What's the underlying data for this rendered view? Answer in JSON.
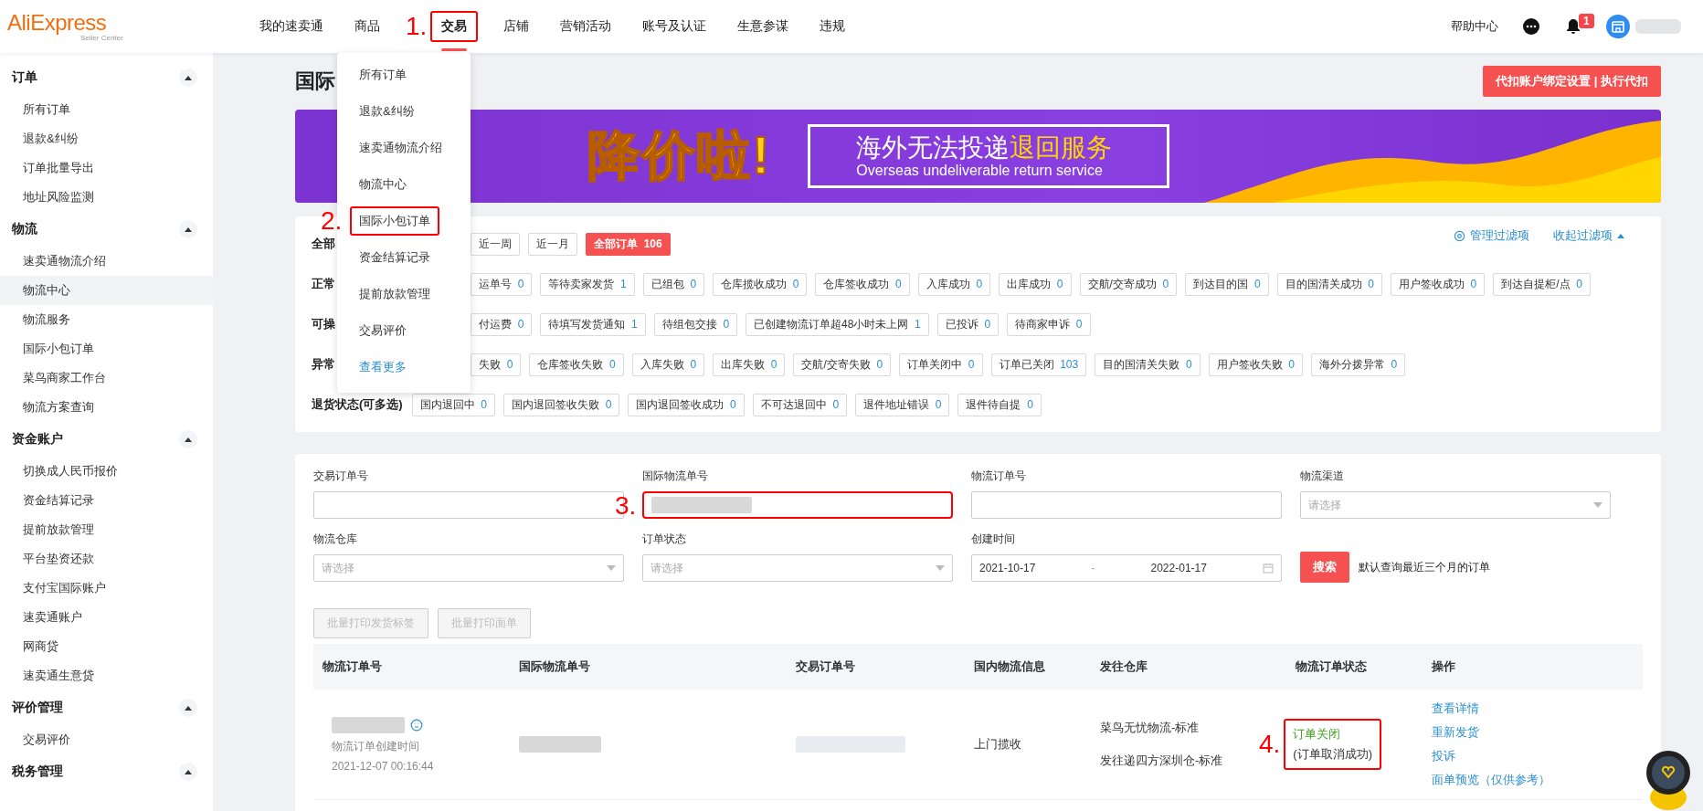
{
  "header": {
    "logo": "AliExpress",
    "logo_sub": "Seller Center",
    "step_label": "1.",
    "nav": [
      {
        "label": "我的速卖通",
        "selected": false,
        "highlighted": false
      },
      {
        "label": "商品",
        "selected": false,
        "highlighted": false
      },
      {
        "label": "交易",
        "selected": true,
        "highlighted": true
      },
      {
        "label": "店铺",
        "selected": false,
        "highlighted": false
      },
      {
        "label": "营销活动",
        "selected": false,
        "highlighted": false
      },
      {
        "label": "账号及认证",
        "selected": false,
        "highlighted": false
      },
      {
        "label": "生意参谋",
        "selected": false,
        "highlighted": false
      },
      {
        "label": "违规",
        "selected": false,
        "highlighted": false
      }
    ],
    "help": "帮助中心",
    "notification_count": "1"
  },
  "dropdown": {
    "step_label": "2.",
    "items": [
      {
        "label": "所有订单",
        "kind": "item",
        "highlighted": false
      },
      {
        "label": "退款&纠纷",
        "kind": "item",
        "highlighted": false
      },
      {
        "label": "速卖通物流介绍",
        "kind": "item",
        "highlighted": false
      },
      {
        "label": "物流中心",
        "kind": "item",
        "highlighted": false
      },
      {
        "label": "国际小包订单",
        "kind": "item",
        "highlighted": true
      },
      {
        "label": "资金结算记录",
        "kind": "item",
        "highlighted": false
      },
      {
        "label": "提前放款管理",
        "kind": "item",
        "highlighted": false
      },
      {
        "label": "交易评价",
        "kind": "item",
        "highlighted": false
      },
      {
        "label": "查看更多",
        "kind": "more",
        "highlighted": false
      }
    ]
  },
  "sidebar": {
    "groups": [
      {
        "title": "订单",
        "expanded": true,
        "items": [
          {
            "label": "所有订单",
            "selected": false
          },
          {
            "label": "退款&纠纷",
            "selected": false
          },
          {
            "label": "订单批量导出",
            "selected": false
          },
          {
            "label": "地址风险监测",
            "selected": false
          }
        ]
      },
      {
        "title": "物流",
        "expanded": true,
        "items": [
          {
            "label": "速卖通物流介绍",
            "selected": false
          },
          {
            "label": "物流中心",
            "selected": true
          },
          {
            "label": "物流服务",
            "selected": false
          },
          {
            "label": "国际小包订单",
            "selected": false
          },
          {
            "label": "菜鸟商家工作台",
            "selected": false
          },
          {
            "label": "物流方案查询",
            "selected": false
          }
        ]
      },
      {
        "title": "资金账户",
        "expanded": true,
        "items": [
          {
            "label": "切换成人民币报价",
            "selected": false
          },
          {
            "label": "资金结算记录",
            "selected": false
          },
          {
            "label": "提前放款管理",
            "selected": false
          },
          {
            "label": "平台垫资还款",
            "selected": false
          },
          {
            "label": "支付宝国际账户",
            "selected": false
          },
          {
            "label": "速卖通账户",
            "selected": false
          },
          {
            "label": "网商贷",
            "selected": false
          },
          {
            "label": "速卖通生意贷",
            "selected": false
          }
        ]
      },
      {
        "title": "评价管理",
        "expanded": true,
        "items": [
          {
            "label": "交易评价",
            "selected": false
          }
        ]
      },
      {
        "title": "税务管理",
        "expanded": true
      }
    ]
  },
  "page": {
    "title": "国际",
    "action_button": "代扣账户绑定设置 | 执行代扣"
  },
  "banner": {
    "headline": "降价啦!",
    "tagline": "海外无法投递",
    "tagline_highlight": "退回服务",
    "subtitle": "Overseas undeliverable return service"
  },
  "filters": {
    "manage": "管理过滤项",
    "collapse": "收起过滤项",
    "rows": [
      {
        "label": "全部",
        "chips": [
          {
            "label": "近一周",
            "selected": false
          },
          {
            "label": "近一月",
            "selected": false
          },
          {
            "label": "全部订单",
            "count": "106",
            "selected": true
          }
        ]
      },
      {
        "label": "正常",
        "chips": [
          {
            "label": "运单号",
            "count": "0",
            "selected": false
          },
          {
            "label": "等待卖家发货",
            "count": "1",
            "selected": false
          },
          {
            "label": "已组包",
            "count": "0",
            "selected": false
          },
          {
            "label": "仓库揽收成功",
            "count": "0",
            "selected": false
          },
          {
            "label": "仓库签收成功",
            "count": "0",
            "selected": false
          },
          {
            "label": "入库成功",
            "count": "0",
            "selected": false
          },
          {
            "label": "出库成功",
            "count": "0",
            "selected": false
          },
          {
            "label": "交航/交寄成功",
            "count": "0",
            "selected": false
          },
          {
            "label": "到达目的国",
            "count": "0",
            "selected": false
          },
          {
            "label": "目的国清关成功",
            "count": "0",
            "selected": false
          },
          {
            "label": "用户签收成功",
            "count": "0",
            "selected": false
          },
          {
            "label": "到达自提柜/点",
            "count": "0",
            "selected": false
          }
        ]
      },
      {
        "label": "可操",
        "chips": [
          {
            "label": "付运费",
            "count": "0",
            "selected": false
          },
          {
            "label": "待填写发货通知",
            "count": "1",
            "selected": false
          },
          {
            "label": "待组包交接",
            "count": "0",
            "selected": false
          },
          {
            "label": "已创建物流订单超48小时未上网",
            "count": "1",
            "selected": false
          },
          {
            "label": "已投诉",
            "count": "0",
            "selected": false
          },
          {
            "label": "待商家申诉",
            "count": "0",
            "selected": false
          }
        ]
      },
      {
        "label": "异常",
        "chips": [
          {
            "label": "失败",
            "count": "0",
            "selected": false
          },
          {
            "label": "仓库签收失败",
            "count": "0",
            "selected": false
          },
          {
            "label": "入库失败",
            "count": "0",
            "selected": false
          },
          {
            "label": "出库失败",
            "count": "0",
            "selected": false
          },
          {
            "label": "交航/交寄失败",
            "count": "0",
            "selected": false
          },
          {
            "label": "订单关闭中",
            "count": "0",
            "selected": false
          },
          {
            "label": "订单已关闭",
            "count": "103",
            "selected": false
          },
          {
            "label": "目的国清关失败",
            "count": "0",
            "selected": false
          },
          {
            "label": "用户签收失败",
            "count": "0",
            "selected": false
          },
          {
            "label": "海外分拨异常",
            "count": "0",
            "selected": false
          }
        ]
      },
      {
        "label": "退货状态(可多选)",
        "chips": [
          {
            "label": "国内退回中",
            "count": "0",
            "selected": false
          },
          {
            "label": "国内退回签收失败",
            "count": "0",
            "selected": false
          },
          {
            "label": "国内退回签收成功",
            "count": "0",
            "selected": false
          },
          {
            "label": "不可达退回中",
            "count": "0",
            "selected": false
          },
          {
            "label": "退件地址错误",
            "count": "0",
            "selected": false
          },
          {
            "label": "退件待自提",
            "count": "0",
            "selected": false
          }
        ]
      }
    ]
  },
  "search": {
    "fields": [
      {
        "label": "交易订单号",
        "kind": "text",
        "blurred": false,
        "highlighted": false
      },
      {
        "label": "国际物流单号",
        "kind": "text",
        "blurred": true,
        "highlighted": true,
        "step_label": "3."
      },
      {
        "label": "物流订单号",
        "kind": "text",
        "blurred": false,
        "highlighted": false
      },
      {
        "label": "物流渠道",
        "kind": "select",
        "placeholder": "请选择"
      },
      {
        "label": "物流仓库",
        "kind": "select",
        "placeholder": "请选择"
      },
      {
        "label": "订单状态",
        "kind": "select",
        "placeholder": "请选择"
      },
      {
        "label": "创建时间",
        "kind": "daterange",
        "start": "2021-10-17",
        "separator": "-",
        "end": "2022-01-17"
      }
    ],
    "search_button": "搜索",
    "note": "默认查询最近三个月的订单",
    "bulk_buttons": [
      {
        "label": "批量打印发货标签",
        "disabled": true
      },
      {
        "label": "批量打印面单",
        "disabled": true
      }
    ]
  },
  "table": {
    "columns": [
      "物流订单号",
      "国际物流单号",
      "交易订单号",
      "国内物流信息",
      "发往仓库",
      "物流订单状态",
      "操作"
    ],
    "rows": [
      {
        "order_blurred": true,
        "created_label": "物流订单创建时间",
        "created_time": "2021-12-07 00:16:44",
        "tracking_blurred": true,
        "trade_blurred": true,
        "domestic_info": "上门揽收",
        "warehouse_lines": [
          "菜鸟无忧物流-标准",
          "发往递四方深圳仓-标准"
        ],
        "status": "订单关闭",
        "status_note": "(订单取消成功)",
        "status_highlighted": true,
        "step_label": "4.",
        "actions": [
          "查看详情",
          "重新发货",
          "投诉",
          "面单预览（仅供参考）"
        ]
      }
    ]
  }
}
